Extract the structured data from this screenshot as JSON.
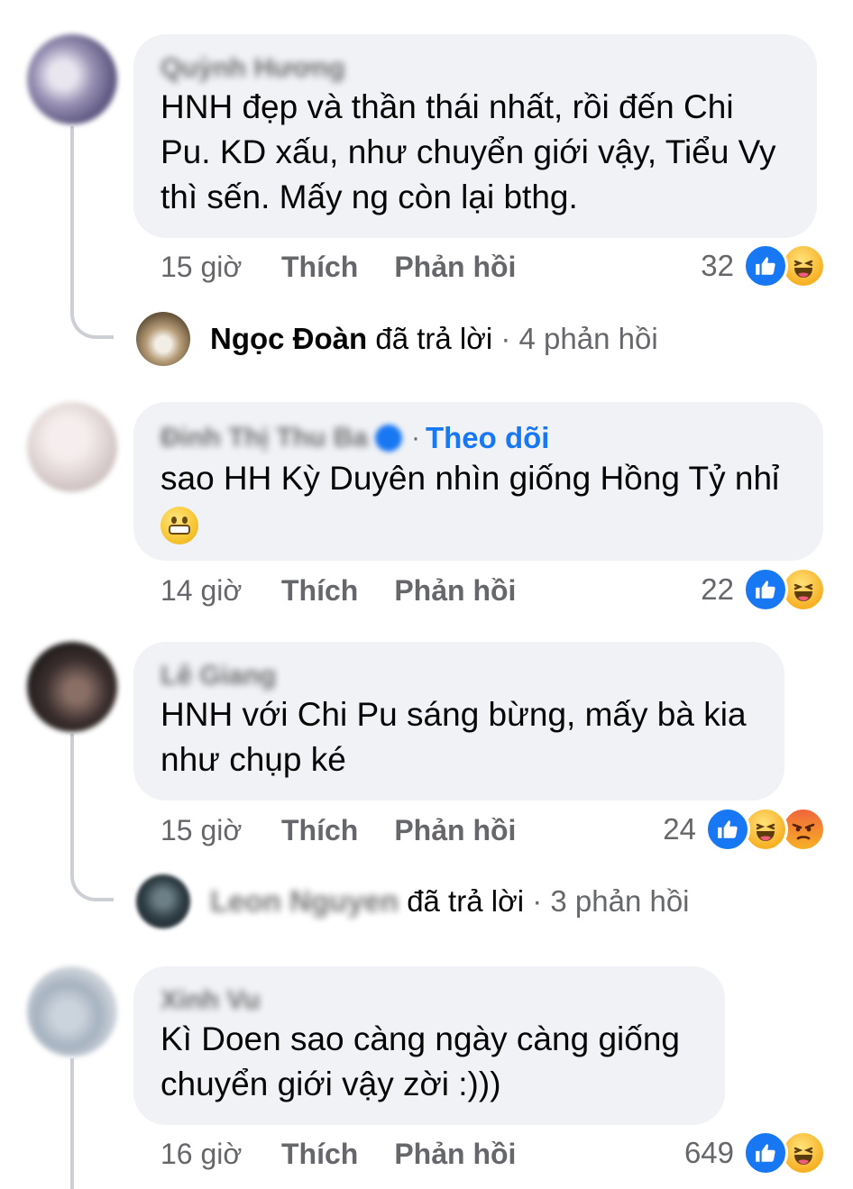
{
  "comments": [
    {
      "author": "Quỳnh Hương",
      "text": "HNH đẹp và thần thái nhất, rồi đến Chi\nPu. KD xấu, như chuyển giới vậy, Tiểu Vy\nthì sến. Mấy ng còn lại bthg.",
      "time": "15 giờ",
      "like_label": "Thích",
      "reply_label": "Phản hồi",
      "reaction_count": "32",
      "reactions": [
        "like-icon",
        "haha-icon"
      ],
      "replies": {
        "name": "Ngọc Đoàn",
        "verb": "đã trả lời",
        "count": "· 4 phản hồi"
      }
    },
    {
      "author": "Đinh Thị Thu Ba",
      "follow": "Theo dõi",
      "separator": "·",
      "text": "sao HH Kỳ Duyên nhìn giống Hồng Tỷ nhỉ",
      "emoji": "grimacing-face-icon",
      "time": "14 giờ",
      "like_label": "Thích",
      "reply_label": "Phản hồi",
      "reaction_count": "22",
      "reactions": [
        "like-icon",
        "haha-icon"
      ]
    },
    {
      "author": "Lê Giang",
      "text": "HNH với Chi Pu sáng bừng, mấy bà kia\nnhư chụp ké",
      "time": "15 giờ",
      "like_label": "Thích",
      "reply_label": "Phản hồi",
      "reaction_count": "24",
      "reactions": [
        "like-icon",
        "haha-icon",
        "angry-icon"
      ],
      "replies": {
        "name": "Leon Nguyen",
        "verb": "đã trả lời",
        "count": "· 3 phản hồi"
      }
    },
    {
      "author": "Xinh Vu",
      "text": "Kì Doen sao càng ngày càng giống\nchuyển giới vậy zời :)))",
      "time": "16 giờ",
      "like_label": "Thích",
      "reply_label": "Phản hồi",
      "reaction_count": "649",
      "reactions": [
        "like-icon",
        "haha-icon"
      ]
    }
  ],
  "colors": {
    "bubble": "#f0f2f5",
    "secondary_text": "#65676b",
    "accent_blue": "#1877f2",
    "thread_line": "#ccd0d5"
  }
}
